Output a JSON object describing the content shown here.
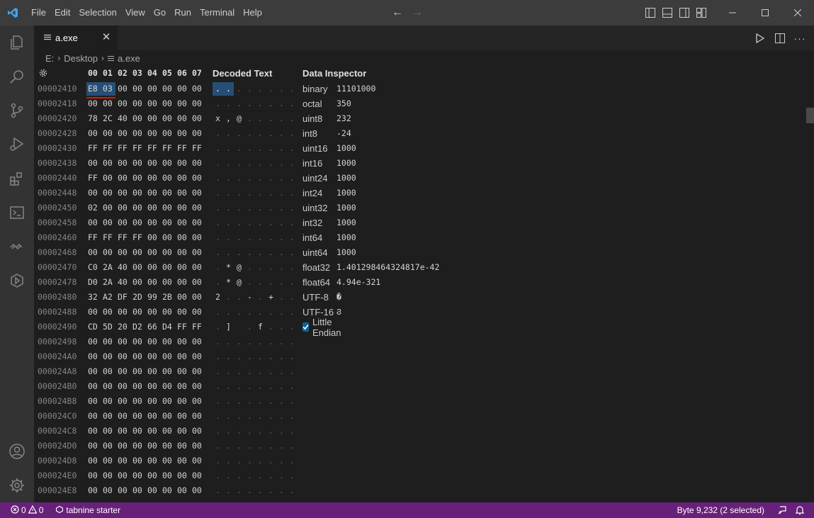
{
  "menu": {
    "items": [
      "File",
      "Edit",
      "Selection",
      "View",
      "Go",
      "Run",
      "Terminal",
      "Help"
    ]
  },
  "tab": {
    "label": "a.exe"
  },
  "breadcrumb": {
    "drive": "E:",
    "folder": "Desktop",
    "file": "a.exe"
  },
  "hex": {
    "columns": [
      "00",
      "01",
      "02",
      "03",
      "04",
      "05",
      "06",
      "07"
    ],
    "decoded_title": "Decoded Text",
    "inspector_title": "Data Inspector",
    "rows": [
      {
        "addr": "00002410",
        "bytes": [
          "E8",
          "03",
          "00",
          "00",
          "00",
          "00",
          "00",
          "00"
        ],
        "text": [
          ".",
          ".",
          ".",
          ".",
          ".",
          ".",
          ".",
          "."
        ]
      },
      {
        "addr": "00002418",
        "bytes": [
          "00",
          "00",
          "00",
          "00",
          "00",
          "00",
          "00",
          "00"
        ],
        "text": [
          ".",
          ".",
          ".",
          ".",
          ".",
          ".",
          ".",
          "."
        ]
      },
      {
        "addr": "00002420",
        "bytes": [
          "78",
          "2C",
          "40",
          "00",
          "00",
          "00",
          "00",
          "00"
        ],
        "text": [
          "x",
          ",",
          "@",
          ".",
          ".",
          ".",
          ".",
          "."
        ]
      },
      {
        "addr": "00002428",
        "bytes": [
          "00",
          "00",
          "00",
          "00",
          "00",
          "00",
          "00",
          "00"
        ],
        "text": [
          ".",
          ".",
          ".",
          ".",
          ".",
          ".",
          ".",
          "."
        ]
      },
      {
        "addr": "00002430",
        "bytes": [
          "FF",
          "FF",
          "FF",
          "FF",
          "FF",
          "FF",
          "FF",
          "FF"
        ],
        "text": [
          ".",
          ".",
          ".",
          ".",
          ".",
          ".",
          ".",
          "."
        ]
      },
      {
        "addr": "00002438",
        "bytes": [
          "00",
          "00",
          "00",
          "00",
          "00",
          "00",
          "00",
          "00"
        ],
        "text": [
          ".",
          ".",
          ".",
          ".",
          ".",
          ".",
          ".",
          "."
        ]
      },
      {
        "addr": "00002440",
        "bytes": [
          "FF",
          "00",
          "00",
          "00",
          "00",
          "00",
          "00",
          "00"
        ],
        "text": [
          ".",
          ".",
          ".",
          ".",
          ".",
          ".",
          ".",
          "."
        ]
      },
      {
        "addr": "00002448",
        "bytes": [
          "00",
          "00",
          "00",
          "00",
          "00",
          "00",
          "00",
          "00"
        ],
        "text": [
          ".",
          ".",
          ".",
          ".",
          ".",
          ".",
          ".",
          "."
        ]
      },
      {
        "addr": "00002450",
        "bytes": [
          "02",
          "00",
          "00",
          "00",
          "00",
          "00",
          "00",
          "00"
        ],
        "text": [
          ".",
          ".",
          ".",
          ".",
          ".",
          ".",
          ".",
          "."
        ]
      },
      {
        "addr": "00002458",
        "bytes": [
          "00",
          "00",
          "00",
          "00",
          "00",
          "00",
          "00",
          "00"
        ],
        "text": [
          ".",
          ".",
          ".",
          ".",
          ".",
          ".",
          ".",
          "."
        ]
      },
      {
        "addr": "00002460",
        "bytes": [
          "FF",
          "FF",
          "FF",
          "FF",
          "00",
          "00",
          "00",
          "00"
        ],
        "text": [
          ".",
          ".",
          ".",
          ".",
          ".",
          ".",
          ".",
          "."
        ]
      },
      {
        "addr": "00002468",
        "bytes": [
          "00",
          "00",
          "00",
          "00",
          "00",
          "00",
          "00",
          "00"
        ],
        "text": [
          ".",
          ".",
          ".",
          ".",
          ".",
          ".",
          ".",
          "."
        ]
      },
      {
        "addr": "00002470",
        "bytes": [
          "C0",
          "2A",
          "40",
          "00",
          "00",
          "00",
          "00",
          "00"
        ],
        "text": [
          ".",
          "*",
          "@",
          ".",
          ".",
          ".",
          ".",
          "."
        ]
      },
      {
        "addr": "00002478",
        "bytes": [
          "D0",
          "2A",
          "40",
          "00",
          "00",
          "00",
          "00",
          "00"
        ],
        "text": [
          ".",
          "*",
          "@",
          ".",
          ".",
          ".",
          ".",
          "."
        ]
      },
      {
        "addr": "00002480",
        "bytes": [
          "32",
          "A2",
          "DF",
          "2D",
          "99",
          "2B",
          "00",
          "00"
        ],
        "text": [
          "2",
          ".",
          ".",
          "-",
          ".",
          "+",
          ".",
          "."
        ]
      },
      {
        "addr": "00002488",
        "bytes": [
          "00",
          "00",
          "00",
          "00",
          "00",
          "00",
          "00",
          "00"
        ],
        "text": [
          ".",
          ".",
          ".",
          ".",
          ".",
          ".",
          ".",
          "."
        ]
      },
      {
        "addr": "00002490",
        "bytes": [
          "CD",
          "5D",
          "20",
          "D2",
          "66",
          "D4",
          "FF",
          "FF"
        ],
        "text": [
          ".",
          "]",
          " ",
          ".",
          "f",
          ".",
          ".",
          "."
        ]
      },
      {
        "addr": "00002498",
        "bytes": [
          "00",
          "00",
          "00",
          "00",
          "00",
          "00",
          "00",
          "00"
        ],
        "text": [
          ".",
          ".",
          ".",
          ".",
          ".",
          ".",
          ".",
          "."
        ]
      },
      {
        "addr": "000024A0",
        "bytes": [
          "00",
          "00",
          "00",
          "00",
          "00",
          "00",
          "00",
          "00"
        ],
        "text": [
          ".",
          ".",
          ".",
          ".",
          ".",
          ".",
          ".",
          "."
        ]
      },
      {
        "addr": "000024A8",
        "bytes": [
          "00",
          "00",
          "00",
          "00",
          "00",
          "00",
          "00",
          "00"
        ],
        "text": [
          ".",
          ".",
          ".",
          ".",
          ".",
          ".",
          ".",
          "."
        ]
      },
      {
        "addr": "000024B0",
        "bytes": [
          "00",
          "00",
          "00",
          "00",
          "00",
          "00",
          "00",
          "00"
        ],
        "text": [
          ".",
          ".",
          ".",
          ".",
          ".",
          ".",
          ".",
          "."
        ]
      },
      {
        "addr": "000024B8",
        "bytes": [
          "00",
          "00",
          "00",
          "00",
          "00",
          "00",
          "00",
          "00"
        ],
        "text": [
          ".",
          ".",
          ".",
          ".",
          ".",
          ".",
          ".",
          "."
        ]
      },
      {
        "addr": "000024C0",
        "bytes": [
          "00",
          "00",
          "00",
          "00",
          "00",
          "00",
          "00",
          "00"
        ],
        "text": [
          ".",
          ".",
          ".",
          ".",
          ".",
          ".",
          ".",
          "."
        ]
      },
      {
        "addr": "000024C8",
        "bytes": [
          "00",
          "00",
          "00",
          "00",
          "00",
          "00",
          "00",
          "00"
        ],
        "text": [
          ".",
          ".",
          ".",
          ".",
          ".",
          ".",
          ".",
          "."
        ]
      },
      {
        "addr": "000024D0",
        "bytes": [
          "00",
          "00",
          "00",
          "00",
          "00",
          "00",
          "00",
          "00"
        ],
        "text": [
          ".",
          ".",
          ".",
          ".",
          ".",
          ".",
          ".",
          "."
        ]
      },
      {
        "addr": "000024D8",
        "bytes": [
          "00",
          "00",
          "00",
          "00",
          "00",
          "00",
          "00",
          "00"
        ],
        "text": [
          ".",
          ".",
          ".",
          ".",
          ".",
          ".",
          ".",
          "."
        ]
      },
      {
        "addr": "000024E0",
        "bytes": [
          "00",
          "00",
          "00",
          "00",
          "00",
          "00",
          "00",
          "00"
        ],
        "text": [
          ".",
          ".",
          ".",
          ".",
          ".",
          ".",
          ".",
          "."
        ]
      },
      {
        "addr": "000024E8",
        "bytes": [
          "00",
          "00",
          "00",
          "00",
          "00",
          "00",
          "00",
          "00"
        ],
        "text": [
          ".",
          ".",
          ".",
          ".",
          ".",
          ".",
          ".",
          "."
        ]
      }
    ],
    "selected_row": 0,
    "selected_bytes": [
      0,
      1
    ]
  },
  "inspector": {
    "rows": [
      {
        "label": "binary",
        "value": "11101000"
      },
      {
        "label": "octal",
        "value": "350"
      },
      {
        "label": "uint8",
        "value": "232"
      },
      {
        "label": "int8",
        "value": "-24"
      },
      {
        "label": "uint16",
        "value": "1000"
      },
      {
        "label": "int16",
        "value": "1000"
      },
      {
        "label": "uint24",
        "value": "1000"
      },
      {
        "label": "int24",
        "value": "1000"
      },
      {
        "label": "uint32",
        "value": "1000"
      },
      {
        "label": "int32",
        "value": "1000"
      },
      {
        "label": "int64",
        "value": "1000"
      },
      {
        "label": "uint64",
        "value": "1000"
      },
      {
        "label": "float32",
        "value": "1.401298464324817e-42"
      },
      {
        "label": "float64",
        "value": "4.94e-321"
      },
      {
        "label": "UTF-8",
        "value": "�"
      },
      {
        "label": "UTF-16",
        "value": "Ϩ"
      }
    ],
    "endian_label": "Little Endian",
    "endian_checked": true
  },
  "status": {
    "errors": "0",
    "warnings": "0",
    "tabnine": "tabnine starter",
    "selection": "Byte 9,232 (2 selected)"
  },
  "colors": {
    "statusbar": "#68217a",
    "selection": "#264f78",
    "underline": "#e51400",
    "accent": "#0e639c"
  }
}
